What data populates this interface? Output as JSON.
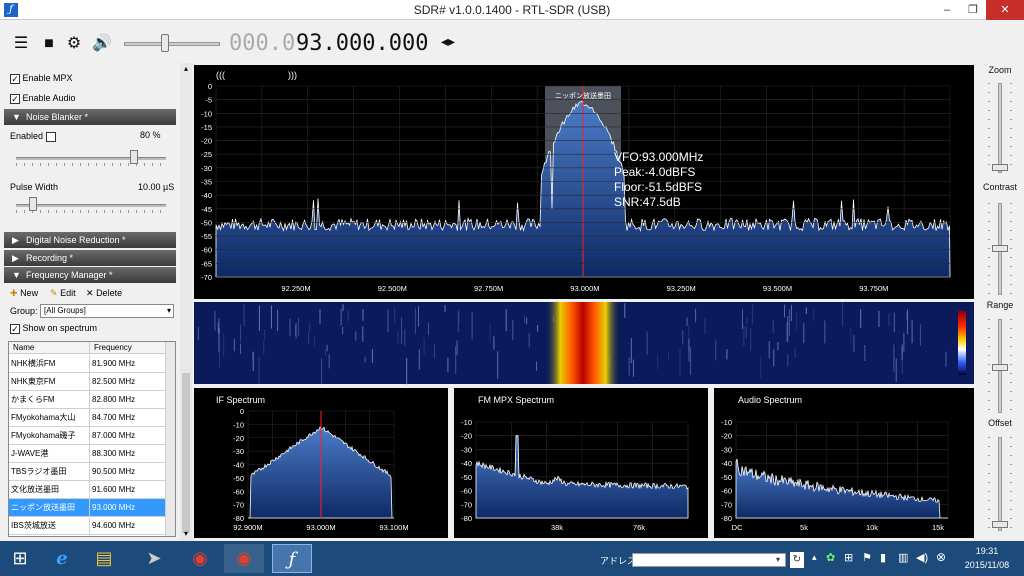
{
  "window": {
    "title": "SDR# v1.0.0.1400 - RTL-SDR (USB)",
    "min": "‒",
    "max": "❐",
    "close": "✕"
  },
  "toolbar": {
    "freq_dim": "000.0",
    "freq_bright": "93.000.000",
    "arrows": "◂▸"
  },
  "left": {
    "enable_mpx": "Enable MPX",
    "enable_audio": "Enable Audio",
    "noise_blanker": "Noise Blanker *",
    "enabled": "Enabled",
    "enabled_value": "80 %",
    "pulse_width": "Pulse Width",
    "pulse_width_value": "10.00 µS",
    "digital_nr": "Digital Noise Reduction *",
    "recording": "Recording *",
    "freq_manager": "Frequency Manager *",
    "new": "New",
    "edit": "Edit",
    "delete": "Delete",
    "group_label": "Group:",
    "group_value": "[All Groups]",
    "show_on_spectrum": "Show on spectrum",
    "col_name": "Name",
    "col_freq": "Frequency",
    "stations": [
      {
        "name": "NHK横浜FM",
        "freq": "81.900 MHz"
      },
      {
        "name": "NHK東京FM",
        "freq": "82.500 MHz"
      },
      {
        "name": "かまくらFM",
        "freq": "82.800 MHz"
      },
      {
        "name": "FMyokohama大山",
        "freq": "84.700 MHz"
      },
      {
        "name": "FMyokohama磯子",
        "freq": "87.000 MHz"
      },
      {
        "name": "J-WAVE港",
        "freq": "88.300 MHz"
      },
      {
        "name": "TBSラジオ墨田",
        "freq": "90.500 MHz"
      },
      {
        "name": "文化放送墨田",
        "freq": "91.600 MHz"
      },
      {
        "name": "ニッポン放送墨田",
        "freq": "93.000 MHz"
      },
      {
        "name": "IBS茨城放送",
        "freq": "94.600 MHz"
      }
    ]
  },
  "right": {
    "zoom": "Zoom",
    "contrast": "Contrast",
    "range": "Range",
    "offset": "Offset"
  },
  "main_spectrum": {
    "stereo_left": "(((",
    "stereo_right": ")))",
    "station_label": "ニッポン放送墨田",
    "vfo": "VFO:93.000MHz",
    "peak": "Peak:-4.0dBFS",
    "floor": "Floor:-51.5dBFS",
    "snr": "SNR:47.5dB",
    "y_ticks": [
      "0",
      "-5",
      "-10",
      "-15",
      "-20",
      "-25",
      "-30",
      "-35",
      "-40",
      "-45",
      "-50",
      "-55",
      "-60",
      "-65",
      "-70"
    ],
    "x_ticks": [
      "92.250M",
      "92.500M",
      "92.750M",
      "93.000M",
      "93.250M",
      "93.500M",
      "93.750M"
    ]
  },
  "if_spectrum": {
    "title": "IF Spectrum",
    "y_ticks": [
      "0",
      "-10",
      "-20",
      "-30",
      "-40",
      "-50",
      "-60",
      "-70",
      "-80"
    ],
    "x_ticks": [
      "92.900M",
      "93.000M",
      "93.100M"
    ]
  },
  "mpx_spectrum": {
    "title": "FM MPX Spectrum",
    "y_ticks": [
      "-10",
      "-20",
      "-30",
      "-40",
      "-50",
      "-60",
      "-70",
      "-80"
    ],
    "x_ticks": [
      "38k",
      "76k"
    ]
  },
  "audio_spectrum": {
    "title": "Audio Spectrum",
    "y_ticks": [
      "-10",
      "-20",
      "-30",
      "-40",
      "-50",
      "-60",
      "-70",
      "-80"
    ],
    "x_ticks": [
      "DC",
      "5k",
      "10k",
      "15k"
    ]
  },
  "taskbar": {
    "address_label": "アドレス",
    "time": "19:31",
    "date": "2015/11/08"
  },
  "colors": {
    "background": "#000000",
    "spectrum_fill": "#1e4a8e",
    "trace": "#ffffff",
    "center_line": "#ff2020",
    "filter_band": "#8a94a8"
  }
}
